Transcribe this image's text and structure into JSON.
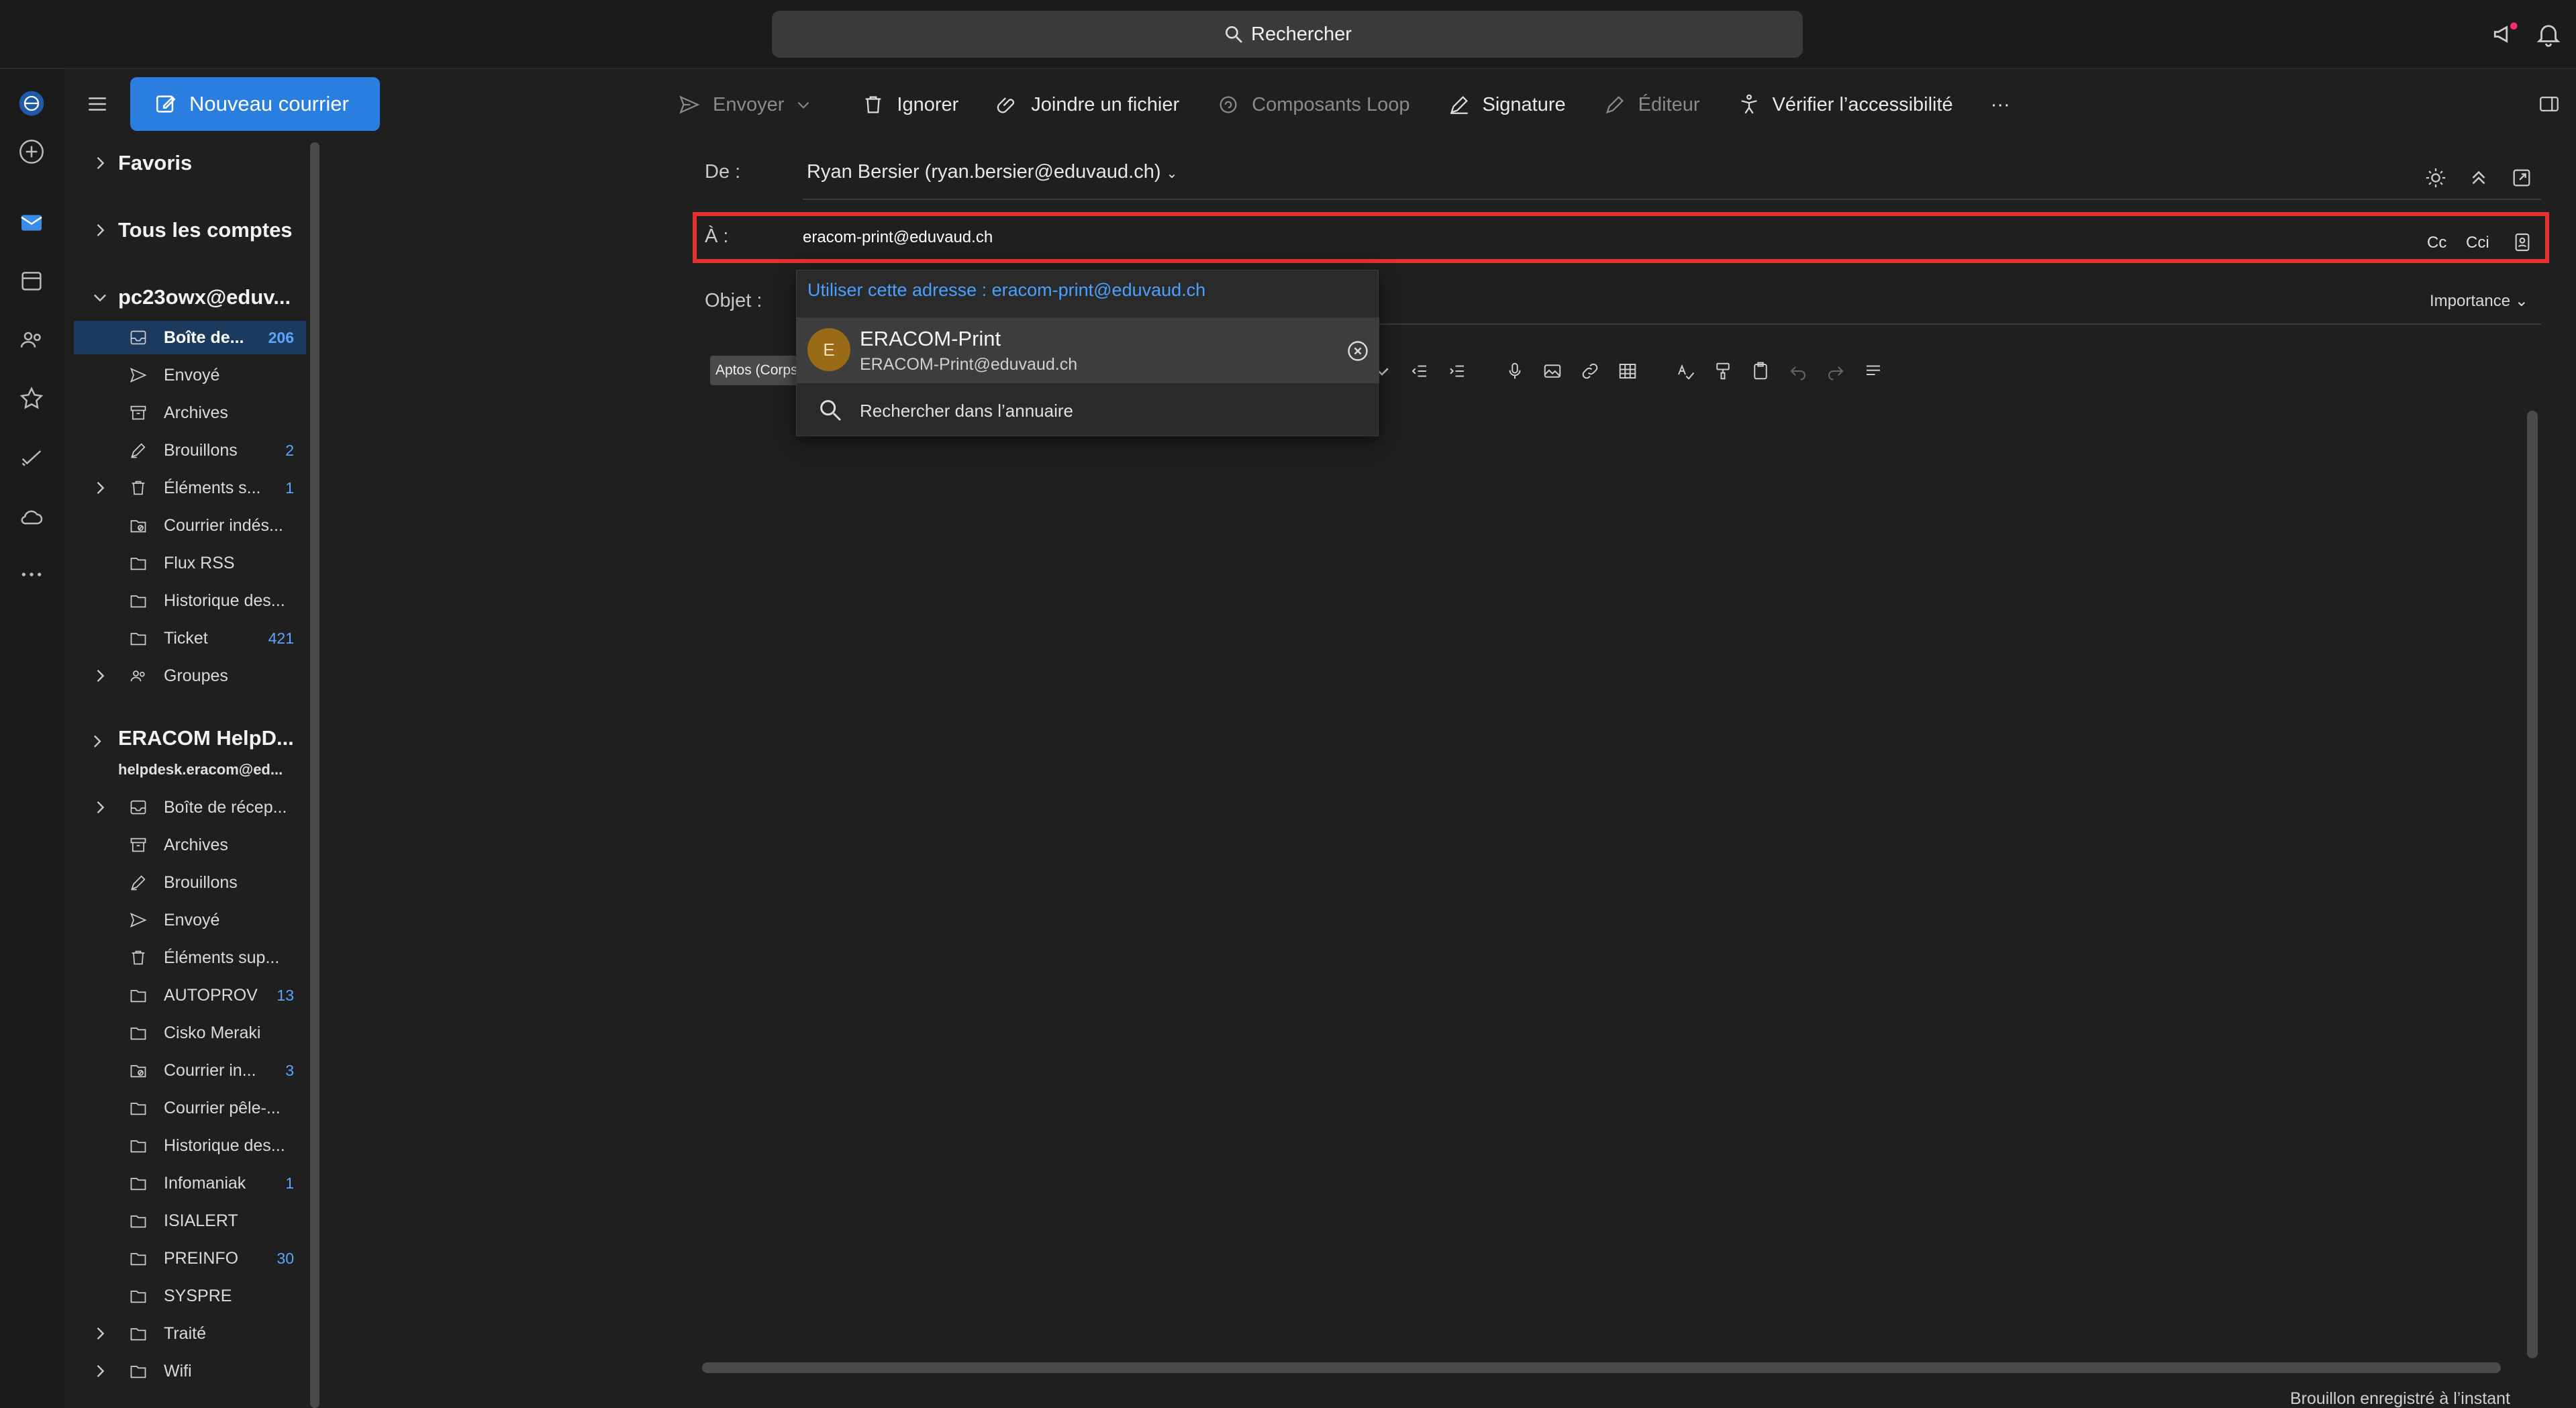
{
  "search": {
    "label": "Rechercher"
  },
  "toolbar": {
    "new_mail": "Nouveau courrier",
    "send": "Envoyer",
    "ignore": "Ignorer",
    "attach": "Joindre un fichier",
    "loop": "Composants Loop",
    "signature": "Signature",
    "editor": "Éditeur",
    "accessibility": "Vérifier l’accessibilité",
    "more": "···"
  },
  "compose": {
    "from_label": "De :",
    "from_value": "Ryan Bersier (ryan.bersier@eduvaud.ch)",
    "to_label": "À :",
    "to_value": "eracom-print@eduvaud.ch",
    "cc": "Cc",
    "bcc": "Cci",
    "subject_label": "Objet :",
    "importance": "Importance",
    "font_name": "Aptos (Corps)"
  },
  "suggest": {
    "use_address": "Utiliser cette adresse : eracom-print@eduvaud.ch",
    "avatar_initial": "E",
    "contact_name": "ERACOM-Print",
    "contact_email": "ERACOM-Print@eduvaud.ch",
    "directory_search": "Rechercher dans l’annuaire"
  },
  "folders": {
    "favorites": "Favoris",
    "all_accounts": "Tous les comptes",
    "account1": "pc23owx@eduv...",
    "account1_items": [
      {
        "label": "Boîte de...",
        "count": "206"
      },
      {
        "label": "Envoyé",
        "count": ""
      },
      {
        "label": "Archives",
        "count": ""
      },
      {
        "label": "Brouillons",
        "count": "2"
      },
      {
        "label": "Éléments s...",
        "count": "1"
      },
      {
        "label": "Courrier indés...",
        "count": ""
      },
      {
        "label": "Flux RSS",
        "count": ""
      },
      {
        "label": "Historique des...",
        "count": ""
      },
      {
        "label": "Ticket",
        "count": "421"
      },
      {
        "label": "Groupes",
        "count": ""
      }
    ],
    "account2": "ERACOM HelpD...",
    "account2_email": "helpdesk.eracom@ed...",
    "account2_items": [
      {
        "label": "Boîte de récep...",
        "count": ""
      },
      {
        "label": "Archives",
        "count": ""
      },
      {
        "label": "Brouillons",
        "count": ""
      },
      {
        "label": "Envoyé",
        "count": ""
      },
      {
        "label": "Éléments sup...",
        "count": ""
      },
      {
        "label": "AUTOPROV",
        "count": "13"
      },
      {
        "label": "Cisko Meraki",
        "count": ""
      },
      {
        "label": "Courrier in...",
        "count": "3"
      },
      {
        "label": "Courrier pêle-...",
        "count": ""
      },
      {
        "label": "Historique des...",
        "count": ""
      },
      {
        "label": "Infomaniak",
        "count": "1"
      },
      {
        "label": "ISIALERT",
        "count": ""
      },
      {
        "label": "PREINFO",
        "count": "30"
      },
      {
        "label": "SYSPRE",
        "count": ""
      },
      {
        "label": "Traité",
        "count": ""
      },
      {
        "label": "Wifi",
        "count": ""
      }
    ]
  },
  "status": {
    "draft_saved": "Brouillon enregistré à l’instant"
  },
  "colors": {
    "accent": "#2a7ee0",
    "highlight_border": "#e53030",
    "link": "#4aa0ff"
  }
}
